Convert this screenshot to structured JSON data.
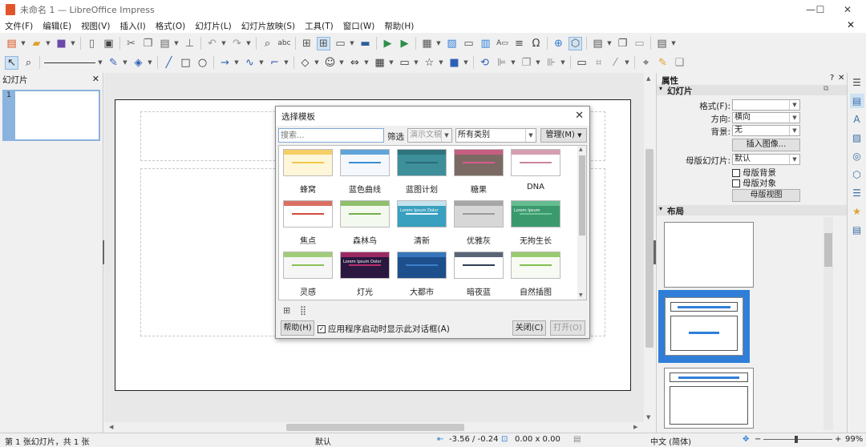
{
  "window": {
    "title": "未命名 1 — LibreOffice Impress",
    "minimize": "—",
    "maximize": "☐",
    "close": "✕"
  },
  "menu": [
    "文件(F)",
    "编辑(E)",
    "视图(V)",
    "插入(I)",
    "格式(O)",
    "幻灯片(L)",
    "幻灯片放映(S)",
    "工具(T)",
    "窗口(W)",
    "帮助(H)"
  ],
  "slides_pane": {
    "title": "幻灯片",
    "close": "✕",
    "thumb_number": "1"
  },
  "sidebar": {
    "title": "属性",
    "help": "?",
    "close": "✕",
    "slide_section": {
      "title": "幻灯片",
      "format_label": "格式(F):",
      "format_value": "",
      "orientation_label": "方向:",
      "orientation_value": "横向",
      "background_label": "背景:",
      "background_value": "无",
      "insert_image_button": "插入图像...",
      "master_label": "母版幻灯片:",
      "master_value": "默认",
      "master_background": "母版背景",
      "master_objects": "母版对象",
      "master_view_button": "母版视图"
    },
    "layout_section": {
      "title": "布局"
    }
  },
  "dialog": {
    "title": "选择模板",
    "close": "✕",
    "search_placeholder": "搜索...",
    "filter_label": "筛选",
    "filter_app": "演示文稿",
    "filter_category": "所有类别",
    "manage_button": "管理(M)",
    "templates": [
      {
        "name": "蜂窝",
        "bg": "#fdf6d8",
        "accent": "#f3c64a"
      },
      {
        "name": "蓝色曲线",
        "bg": "#f4f8fc",
        "accent": "#3b8fd0"
      },
      {
        "name": "蓝图计划",
        "bg": "#3d8f9a",
        "accent": "#2a6b75"
      },
      {
        "name": "糖果",
        "bg": "#7b6a64",
        "accent": "#d95b8a"
      },
      {
        "name": "DNA",
        "bg": "#ffffff",
        "accent": "#c9879c"
      },
      {
        "name": "焦点",
        "bg": "#ffffff",
        "accent": "#d24b3c"
      },
      {
        "name": "森林鸟",
        "bg": "#f4f9ef",
        "accent": "#76b04a"
      },
      {
        "name": "清新",
        "bg": "#3aa0bf",
        "accent": "#e8f4fa"
      },
      {
        "name": "优雅灰",
        "bg": "#d7d7d7",
        "accent": "#9a9a9a"
      },
      {
        "name": "无拘生长",
        "bg": "#3a9a6e",
        "accent": "#6fc59a"
      },
      {
        "name": "灵感",
        "bg": "#f6f6f6",
        "accent": "#8cc05a"
      },
      {
        "name": "灯光",
        "bg": "#2a1840",
        "accent": "#b8306c"
      },
      {
        "name": "大都市",
        "bg": "#1d4f8c",
        "accent": "#3f7fc7"
      },
      {
        "name": "暗夜蓝",
        "bg": "#ffffff",
        "accent": "#2e3e55"
      },
      {
        "name": "自然插图",
        "bg": "#f7faf2",
        "accent": "#7fbf4f"
      }
    ],
    "template_subtitles": [
      "Lorem Ipsum",
      "Lorem Ipsum Dolor",
      "Lorem Ipsum Dolor"
    ],
    "help_button": "帮助(H)",
    "show_on_startup": "应用程序启动时显示此对话框(A)",
    "close_button": "关闭(C)",
    "open_button": "打开(O)"
  },
  "status": {
    "slide_info": "第 1 张幻灯片，共 1 张",
    "master": "默认",
    "position": "-3.56 / -0.24",
    "size": "0.00 x 0.00",
    "language": "中文 (简体)",
    "zoom": "99%"
  },
  "colors": {
    "accent": "#2f7ed8",
    "selection": "#cfe2f3",
    "layout_selected": "#2f7ed8"
  }
}
